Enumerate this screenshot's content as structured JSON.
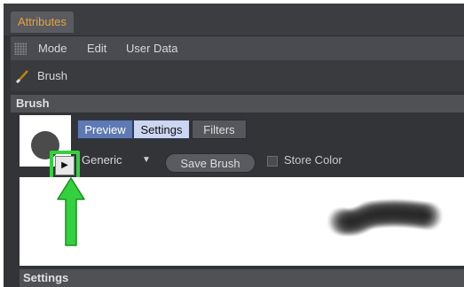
{
  "tabbar": {
    "active_tab": "Attributes"
  },
  "menubar": {
    "items": [
      "Mode",
      "Edit",
      "User Data"
    ]
  },
  "object": {
    "label": "Brush"
  },
  "sections": {
    "brush": "Brush",
    "settings": "Settings"
  },
  "brush_panel": {
    "tabs": [
      {
        "label": "Preview",
        "state": "active"
      },
      {
        "label": "Settings",
        "state": "selected"
      },
      {
        "label": "Filters",
        "state": "normal"
      }
    ],
    "preset_dropdown": "Generic",
    "save_button": "Save Brush",
    "store_color_label": "Store Color",
    "store_color_checked": false
  },
  "colors": {
    "accent": "#e6a23c",
    "highlight": "#33d13d",
    "tab_active": "#5e79b3",
    "tab_selected": "#cdd6f0"
  },
  "icons": [
    "grip-icon",
    "brush-icon",
    "chevron-down-icon",
    "play-triangle-icon"
  ]
}
